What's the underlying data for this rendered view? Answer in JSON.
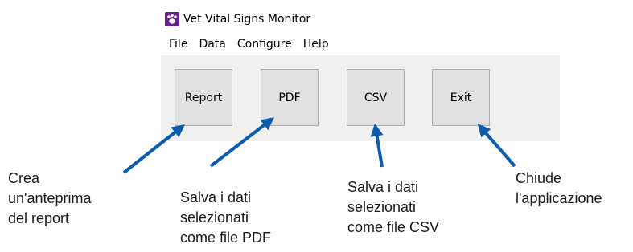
{
  "window": {
    "title": "Vet Vital Signs Monitor",
    "app_icon": "paw-icon",
    "menu": [
      {
        "label": "File"
      },
      {
        "label": "Data"
      },
      {
        "label": "Configure"
      },
      {
        "label": "Help"
      }
    ],
    "buttons": {
      "report": "Report",
      "pdf": "PDF",
      "csv": "CSV",
      "exit": "Exit"
    }
  },
  "callouts": {
    "report": [
      "Crea",
      "un'anteprima",
      "del report"
    ],
    "pdf": [
      "Salva i dati",
      "selezionati",
      "come file PDF"
    ],
    "csv": [
      "Salva i dati",
      "selezionati",
      "come file CSV"
    ],
    "exit": [
      "Chiude",
      "l'applicazione"
    ]
  },
  "colors": {
    "arrow": "#0b5cad",
    "button_face": "#e1e1e1",
    "icon_bg": "#6a1f8e"
  }
}
